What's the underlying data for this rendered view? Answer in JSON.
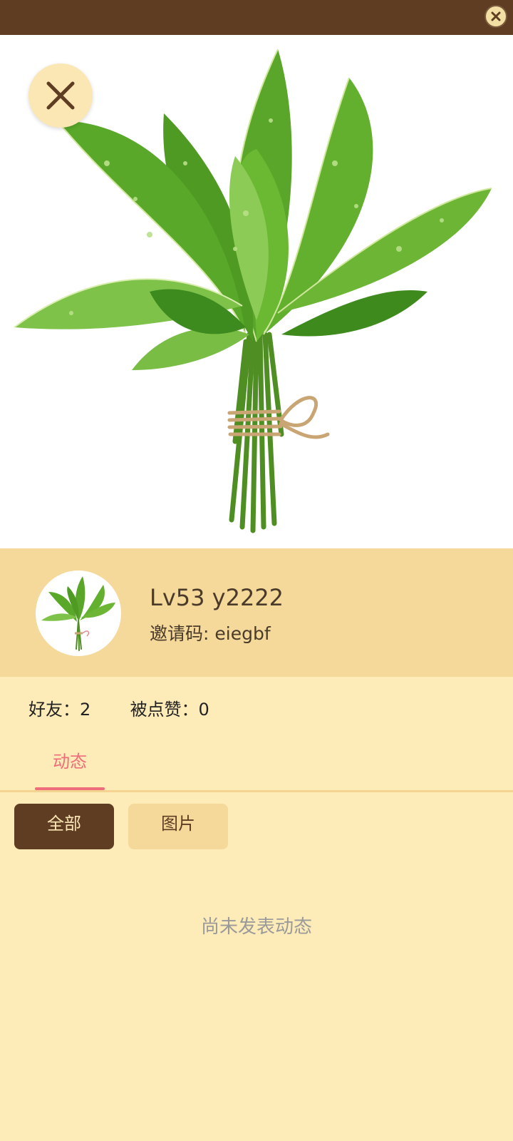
{
  "header": {
    "close_icon": "close-circle-icon"
  },
  "hero": {
    "image": "plant-bouquet",
    "close_icon": "close-icon"
  },
  "profile": {
    "name": "Lv53 y2222",
    "invite": "邀请码: eiegbf"
  },
  "stats": {
    "friends": "好友：2",
    "likes": "被点赞：0"
  },
  "tabs": [
    {
      "label": "动态",
      "active": true
    }
  ],
  "filters": [
    {
      "label": "全部",
      "active": true
    },
    {
      "label": "图片",
      "active": false
    }
  ],
  "empty_text": "尚未发表动态",
  "colors": {
    "topbar": "#5e3d23",
    "profile_bg": "#f5d99a",
    "page_bg": "#fdebb8",
    "accent": "#ef6d7a"
  }
}
